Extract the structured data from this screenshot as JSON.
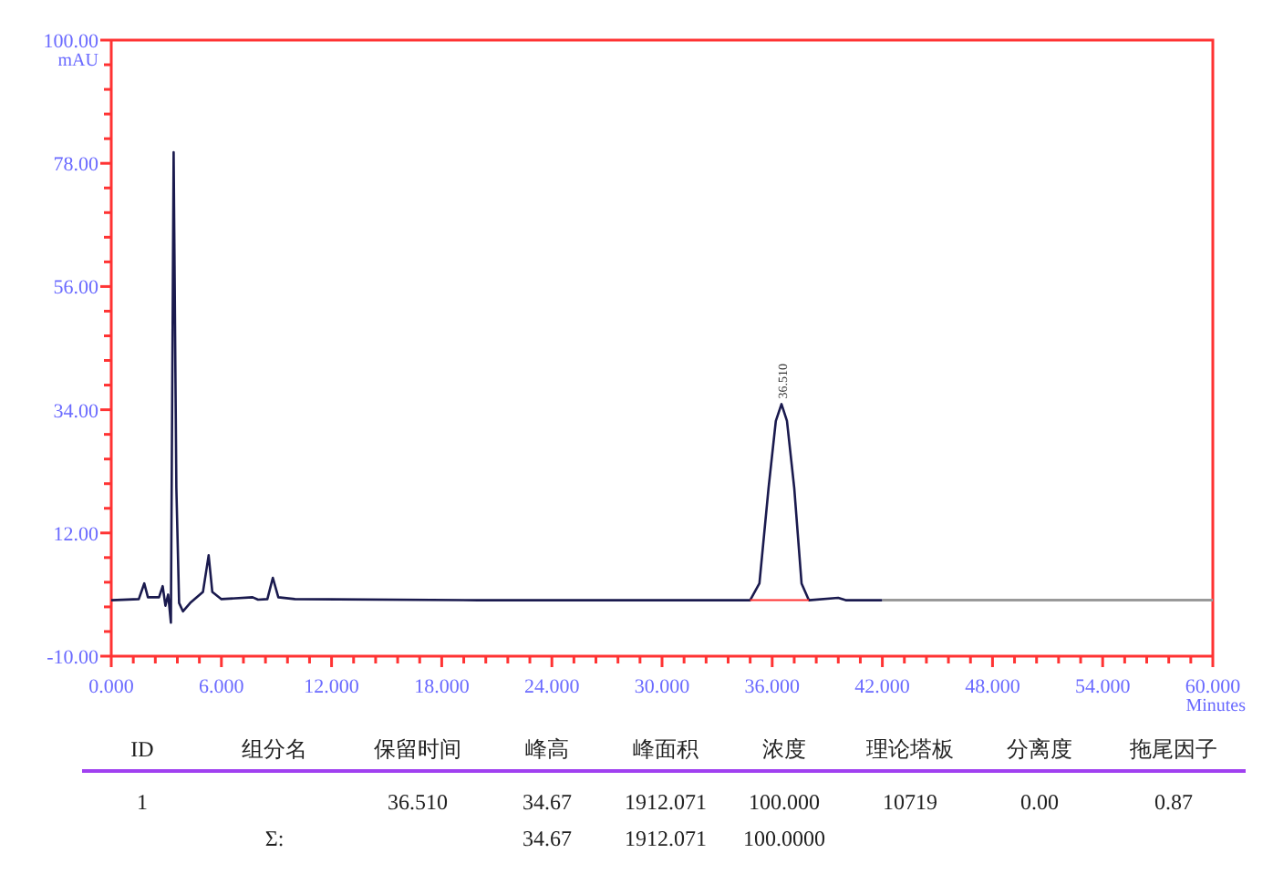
{
  "chromatogram": {
    "chart_data": {
      "type": "line",
      "xlabel": "Minutes",
      "ylabel": "mAU",
      "x": [
        0,
        1.5,
        1.8,
        2.0,
        2.6,
        2.8,
        2.95,
        3.1,
        3.25,
        3.4,
        3.55,
        3.7,
        3.9,
        4.3,
        5.0,
        5.3,
        5.5,
        6,
        7.7,
        8.0,
        8.5,
        8.8,
        9.1,
        10,
        20,
        33,
        34.8,
        35.3,
        35.8,
        36.2,
        36.51,
        36.8,
        37.2,
        37.6,
        38,
        39.6,
        40,
        42,
        48,
        54,
        60
      ],
      "series": [
        {
          "color": "#1a1a4e",
          "values": [
            0,
            0.2,
            3,
            0.5,
            0.5,
            2.5,
            -1,
            1,
            -4,
            80,
            20,
            -0.5,
            -2,
            -0.5,
            1.5,
            8,
            1.5,
            0.2,
            0.5,
            0.1,
            0.2,
            4,
            0.5,
            0.2,
            0,
            0,
            0,
            3,
            20,
            32,
            35,
            32,
            20,
            3,
            0,
            0.4,
            0,
            0,
            null,
            null,
            null
          ]
        },
        {
          "color": "#999999",
          "values": [
            null,
            null,
            null,
            null,
            null,
            null,
            null,
            null,
            null,
            null,
            null,
            null,
            null,
            null,
            null,
            null,
            null,
            null,
            null,
            null,
            null,
            null,
            null,
            null,
            null,
            null,
            null,
            null,
            null,
            null,
            null,
            null,
            null,
            null,
            null,
            null,
            null,
            0,
            0,
            0,
            0
          ]
        },
        {
          "color": "#ff3333",
          "values": [
            null,
            null,
            null,
            null,
            null,
            null,
            null,
            null,
            null,
            null,
            null,
            null,
            null,
            null,
            null,
            null,
            null,
            null,
            null,
            null,
            null,
            null,
            null,
            null,
            null,
            null,
            0,
            0,
            0,
            0,
            0,
            0,
            0,
            0,
            0,
            null,
            null,
            null,
            null,
            null,
            null
          ]
        }
      ],
      "xlim": [
        0,
        60
      ],
      "ylim": [
        -10,
        100
      ],
      "xticks": [
        {
          "value": 0,
          "label": "0.000"
        },
        {
          "value": 6,
          "label": "6.000"
        },
        {
          "value": 12,
          "label": "12.000"
        },
        {
          "value": 18,
          "label": "18.000"
        },
        {
          "value": 24,
          "label": "24.000"
        },
        {
          "value": 30,
          "label": "30.000"
        },
        {
          "value": 36,
          "label": "36.000"
        },
        {
          "value": 42,
          "label": "42.000"
        },
        {
          "value": 48,
          "label": "48.000"
        },
        {
          "value": 54,
          "label": "54.000"
        },
        {
          "value": 60,
          "label": "60.000"
        }
      ],
      "yticks": [
        {
          "value": -10,
          "label": "-10.00"
        },
        {
          "value": 12,
          "label": "12.00"
        },
        {
          "value": 34,
          "label": "34.00"
        },
        {
          "value": 56,
          "label": "56.00"
        },
        {
          "value": 78,
          "label": "78.00"
        },
        {
          "value": 100,
          "label": "100.00"
        }
      ],
      "annotations": [
        {
          "x": 36.5,
          "y": 35,
          "text": "36.510"
        }
      ]
    }
  },
  "peak_table": {
    "columns": [
      "ID",
      "组分名",
      "保留时间",
      "峰高",
      "峰面积",
      "浓度",
      "理论塔板",
      "分离度",
      "拖尾因子"
    ],
    "rows": [
      {
        "cells": [
          "1",
          null,
          "36.510",
          "34.67",
          "1912.071",
          "100.000",
          "10719",
          "0.00",
          "0.87"
        ]
      },
      {
        "cells": [
          null,
          "Σ:",
          null,
          "34.67",
          "1912.071",
          "100.0000",
          null,
          null,
          null
        ]
      }
    ]
  }
}
